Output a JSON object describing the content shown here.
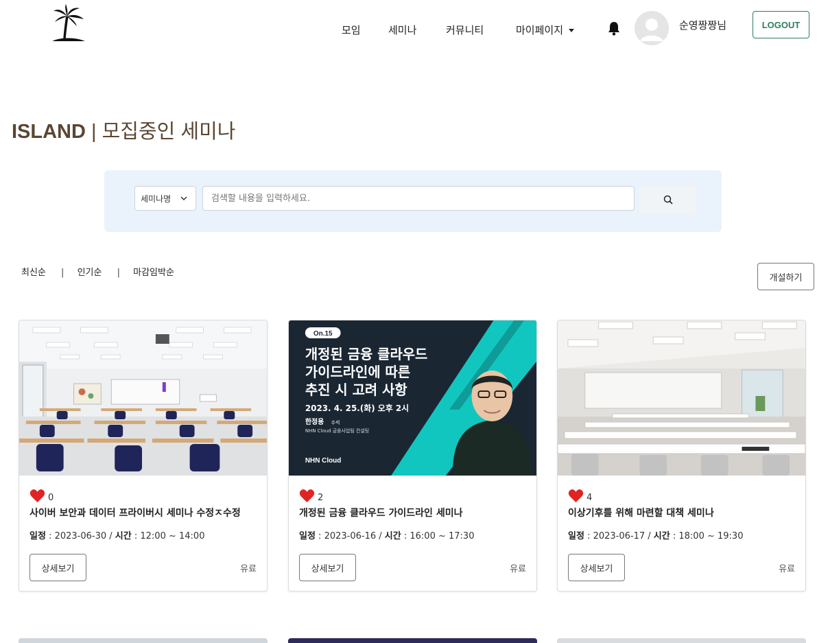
{
  "header": {
    "nav": [
      "모임",
      "세미나",
      "커뮤니티",
      "마이페이지"
    ],
    "user_name": "순영짱짱님",
    "logout_label": "LOGOUT"
  },
  "page": {
    "brand": "ISLAND",
    "separator": " | ",
    "title": "모집중인 세미나"
  },
  "search": {
    "category": "세미나명",
    "placeholder": "검색할 내용을 입력하세요."
  },
  "sort": {
    "options": [
      "최신순",
      "인기순",
      "마감임박순"
    ],
    "separator": "|"
  },
  "open_label": "개설하기",
  "cards": [
    {
      "likes": "0",
      "title": "사이버 보안과 데이터 프라이버시 세미나 수정ㅈ수정",
      "schedule_label": "일정",
      "date": "2023-06-30",
      "time_label": "시간",
      "time": "12:00 ~ 14:00",
      "detail_label": "상세보기",
      "price_type": "유료"
    },
    {
      "likes": "2",
      "title": "개정된 금융 클라우드 가이드라인 세미나",
      "schedule_label": "일정",
      "date": "2023-06-16",
      "time_label": "시간",
      "time": "16:00 ~ 17:30",
      "detail_label": "상세보기",
      "price_type": "유료",
      "poster": {
        "badge": "On.15",
        "line1": "개정된 금융 클라우드",
        "line2": "가이드라인에 따른",
        "line3": "추진 시 고려 사항",
        "date": "2023. 4. 25.(화) 오후 2시",
        "speaker": "한정용",
        "speaker_title": "수석",
        "org": "NHN Cloud 금융사업팀 컨설팅",
        "logo": "NHN Cloud"
      }
    },
    {
      "likes": "4",
      "title": "이상기후를 위해 마련할 대책 세미나",
      "schedule_label": "일정",
      "date": "2023-06-17",
      "time_label": "시간",
      "time": "18:00 ~ 19:30",
      "detail_label": "상세보기",
      "price_type": "유료"
    }
  ],
  "colors": {
    "accent_green": "#2e7d5b",
    "title_brown": "#5a4632",
    "search_bg": "#eaf3fb",
    "heart_red": "#e02424",
    "poster_dark": "#1b2633",
    "poster_teal": "#12c6c0"
  },
  "icons": {
    "logo": "palm-tree-icon",
    "bell": "bell-icon",
    "avatar": "user-avatar-icon",
    "search": "search-icon",
    "heart": "heart-icon"
  }
}
